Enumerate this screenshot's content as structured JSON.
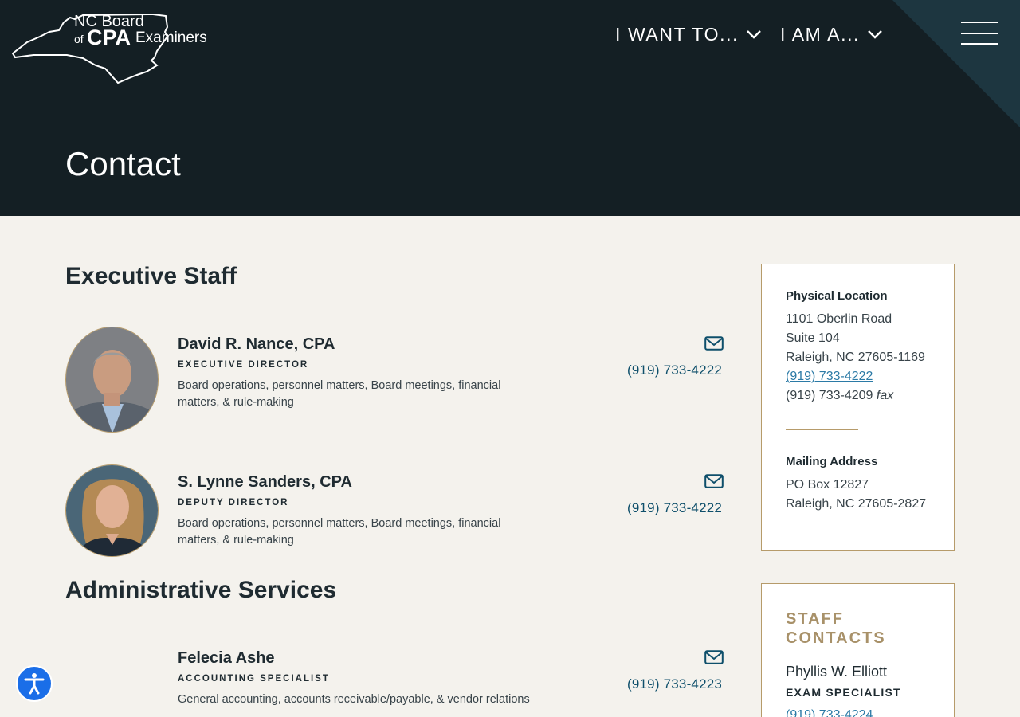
{
  "header": {
    "logo": {
      "line1": "NC Board",
      "line2": "of",
      "line3": "CPA",
      "line4": "Examiners"
    },
    "nav": {
      "want": "I WANT TO...",
      "am": "I AM A..."
    },
    "page_title": "Contact"
  },
  "sections": {
    "executive": "Executive Staff",
    "admin": "Administrative Services"
  },
  "staff": [
    {
      "name": "David R. Nance, CPA",
      "role": "EXECUTIVE DIRECTOR",
      "desc": "Board operations, personnel matters, Board meetings, financial matters, & rule-making",
      "phone": "(919) 733-4222"
    },
    {
      "name": "S. Lynne Sanders, CPA",
      "role": "DEPUTY DIRECTOR",
      "desc": "Board operations, personnel matters, Board meetings, financial matters, & rule-making",
      "phone": "(919) 733-4222"
    },
    {
      "name": "Felecia Ashe",
      "role": "ACCOUNTING SPECIALIST",
      "desc": "General accounting, accounts receivable/payable, & vendor relations",
      "phone": "(919) 733-4223"
    }
  ],
  "sidebar": {
    "physical": {
      "heading": "Physical Location",
      "line1": "1101 Oberlin Road",
      "line2": "Suite 104",
      "line3": "Raleigh, NC 27605-1169",
      "phone": "(919) 733-4222",
      "fax_number": "(919) 733-4209",
      "fax_label": "fax"
    },
    "mailing": {
      "heading": "Mailing Address",
      "line1": "PO Box 12827",
      "line2": "Raleigh, NC 27605-2827"
    },
    "staff_contacts": {
      "title": "STAFF CONTACTS",
      "name": "Phyllis W. Elliott",
      "role": "EXAM SPECIALIST",
      "phone": "(919) 733-4224"
    }
  },
  "colors": {
    "header_bg": "#141f24",
    "page_bg": "#f4f2ed",
    "link": "#0e4f6b",
    "accent_gold": "#b69b6a",
    "a11y_blue": "#1a6ee8"
  },
  "icons": [
    "nc-state-outline-icon",
    "chevron-down-icon",
    "hamburger-menu-icon",
    "envelope-icon",
    "accessibility-icon"
  ]
}
